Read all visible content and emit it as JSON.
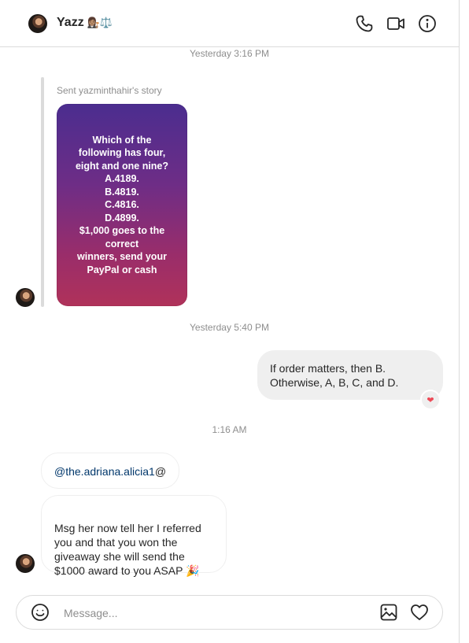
{
  "header": {
    "name": "Yazz",
    "name_emoji": "👩🏽‍⚖️⚖️",
    "icons": [
      "phone-icon",
      "video-camera-icon",
      "info-icon"
    ]
  },
  "thread": {
    "timestamp_1": "Yesterday 3:16 PM",
    "story": {
      "label": "Sent yazminthahir's story",
      "text": "Which of the\nfollowing has four,\neight and one nine?\nA.4189.\nB.4819.\nC.4816.\nD.4899.\n$1,000 goes to the\ncorrect\nwinners, send your\nPayPal  or cash"
    },
    "timestamp_2": "Yesterday 5:40 PM",
    "outgoing": {
      "text": "If order matters, then B. Otherwise, A, B, C, and D.",
      "reaction": "❤"
    },
    "timestamp_3": "1:16 AM",
    "incoming_1": {
      "mention": "@the.adriana.alicia1",
      "suffix": "@"
    },
    "incoming_2": {
      "text": "Msg her now tell her I referred you and that you won the giveaway she will send the $1000 award to you ASAP 🎉"
    }
  },
  "composer": {
    "placeholder": "Message...",
    "icons": [
      "smile-icon",
      "image-icon",
      "heart-icon"
    ]
  },
  "colors": {
    "link": "#00376b",
    "bubble_gray": "#efefef",
    "border": "#dbdbdb",
    "muted": "#8e8e8e",
    "reaction": "#ed4956"
  }
}
